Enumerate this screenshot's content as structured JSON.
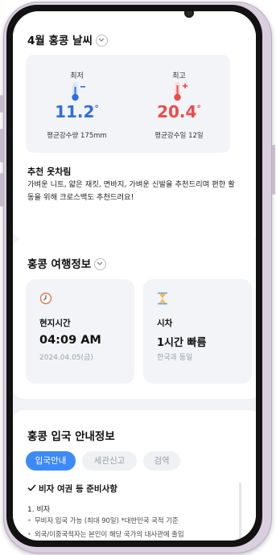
{
  "weather": {
    "title": "4월 홍콩 날씨",
    "low": {
      "label": "최저",
      "value": "11.2",
      "unit": "°",
      "note": "평균강수량 175mm"
    },
    "high": {
      "label": "최고",
      "value": "20.4",
      "unit": "°",
      "note": "평균강수일 12일"
    },
    "outfit_title": "추천 옷차림",
    "outfit_text": "가벼운 니트, 얇은 재킷, 면바지, 가벼운 신발을 추천드리며 편한 활동을 위해 크로스백도 추천드려요!"
  },
  "travel": {
    "title": "홍콩 여행정보",
    "cards": [
      {
        "icon": "clock-icon",
        "label": "현지시간",
        "value": "04:09 AM",
        "sub": "2024.04.05(금)"
      },
      {
        "icon": "hourglass-icon",
        "label": "시차",
        "value": "1시간 빠름",
        "sub": "한국과 동일"
      }
    ]
  },
  "entry": {
    "title": "홍콩 입국 안내정보",
    "tabs": [
      "입국안내",
      "세관신고",
      "검역"
    ],
    "section_title": "비자 여권 등 준비사항",
    "item_heading": "1. 비자",
    "bullets": [
      "무비자 입국 가능 (최대 90일) *대한민국 국적 기준",
      "외국/이중국적자는 본인이 해당 국가의 대사관에 출입"
    ]
  },
  "colors": {
    "cold": "#2f6fe0",
    "hot": "#ec4a4a",
    "accent": "#3d8af7"
  }
}
